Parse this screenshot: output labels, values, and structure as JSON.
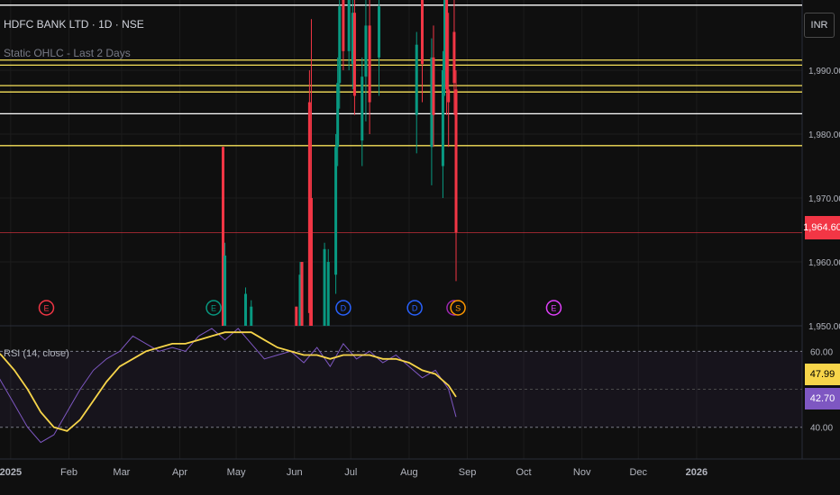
{
  "header": {
    "title": "HDFC BANK LTD · 1D · NSE",
    "indicator": "Static OHLC - Last 2 Days"
  },
  "currency_button": "INR",
  "last_price": "1,964.60",
  "rsi_panel": {
    "label": "RSI (14, close)",
    "ma_value": "47.99",
    "rsi_value": "42.70"
  },
  "colors": {
    "up": "#089981",
    "down": "#f23645",
    "level_white": "#ffffff",
    "level_yellow": "#f7e25a",
    "rsi": "#7e57c2",
    "rsi_ma": "#f7d54a",
    "bg": "#0f0f0f"
  },
  "chart_data": [
    {
      "type": "candlestick",
      "title": "HDFC BANK LTD · 1D · NSE",
      "ylim": [
        1950,
        2001
      ],
      "y_ticks": [
        "1,990.00",
        "1,980.00",
        "1,970.00",
        "1,960.00",
        "1,950.00"
      ],
      "x_ticks": [
        "2025",
        "Feb",
        "Mar",
        "Apr",
        "May",
        "Jun",
        "Jul",
        "Aug",
        "Sep",
        "Oct",
        "Nov",
        "Dec",
        "2026"
      ],
      "levels": [
        {
          "price": 2000.2,
          "color": "white"
        },
        {
          "price": 1991.6,
          "color": "yellow"
        },
        {
          "price": 1990.8,
          "color": "yellow"
        },
        {
          "price": 1987.6,
          "color": "yellow"
        },
        {
          "price": 1986.6,
          "color": "yellow"
        },
        {
          "price": 1983.2,
          "color": "white"
        },
        {
          "price": 1978.2,
          "color": "yellow"
        },
        {
          "price": 1964.6,
          "color": "red"
        }
      ],
      "candles": [
        {
          "date": "2025-04-24",
          "open": 1978,
          "close": 1950,
          "high": 1978,
          "low": 1950
        },
        {
          "date": "2025-04-25",
          "open": 1950,
          "close": 1961,
          "high": 1963,
          "low": 1950
        },
        {
          "date": "2025-05-06",
          "open": 1950,
          "close": 1955,
          "high": 1956,
          "low": 1950
        },
        {
          "date": "2025-05-09",
          "open": 1950,
          "close": 1953,
          "high": 1954,
          "low": 1950
        },
        {
          "date": "2025-06-02",
          "open": 1953,
          "close": 1950,
          "high": 1953,
          "low": 1950
        },
        {
          "date": "2025-06-04",
          "open": 1950,
          "close": 1958,
          "high": 1960,
          "low": 1950
        },
        {
          "date": "2025-06-05",
          "open": 1960,
          "close": 1950,
          "high": 1960,
          "low": 1950
        },
        {
          "date": "2025-06-09",
          "open": 1985,
          "close": 1952,
          "high": 1990,
          "low": 1950
        },
        {
          "date": "2025-06-10",
          "open": 1970,
          "close": 1950,
          "high": 1998,
          "low": 1950
        },
        {
          "date": "2025-06-17",
          "open": 1950,
          "close": 1962,
          "high": 1963,
          "low": 1950
        },
        {
          "date": "2025-06-19",
          "open": 1950,
          "close": 1960,
          "high": 1962,
          "low": 1950
        },
        {
          "date": "2025-06-23",
          "open": 1958,
          "close": 1978,
          "high": 1980,
          "low": 1955
        },
        {
          "date": "2025-06-24",
          "open": 1978,
          "close": 1988,
          "high": 1992,
          "low": 1975
        },
        {
          "date": "2025-06-25",
          "open": 1988,
          "close": 2000,
          "high": 2001,
          "low": 1984
        },
        {
          "date": "2025-06-27",
          "open": 2001,
          "close": 1993,
          "high": 2001,
          "low": 1990
        },
        {
          "date": "2025-06-30",
          "open": 1993,
          "close": 2001,
          "high": 2001,
          "low": 1990
        },
        {
          "date": "2025-07-02",
          "open": 1991,
          "close": 1999,
          "high": 2001,
          "low": 1987
        },
        {
          "date": "2025-07-03",
          "open": 1999,
          "close": 1986,
          "high": 2001,
          "low": 1983
        },
        {
          "date": "2025-07-07",
          "open": 1979,
          "close": 1989,
          "high": 1992,
          "low": 1975
        },
        {
          "date": "2025-07-09",
          "open": 1989,
          "close": 1997,
          "high": 2001,
          "low": 1982
        },
        {
          "date": "2025-07-11",
          "open": 1997,
          "close": 1985,
          "high": 2001,
          "low": 1980
        },
        {
          "date": "2025-07-16",
          "open": 1992,
          "close": 2000,
          "high": 2001,
          "low": 1986
        },
        {
          "date": "2025-08-05",
          "open": 1983,
          "close": 1994,
          "high": 1996,
          "low": 1977
        },
        {
          "date": "2025-08-08",
          "open": 2001,
          "close": 1991,
          "high": 2001,
          "low": 1985
        },
        {
          "date": "2025-08-13",
          "open": 1978,
          "close": 1992,
          "high": 1995,
          "low": 1972
        },
        {
          "date": "2025-08-14",
          "open": 1992,
          "close": 1983,
          "high": 1997,
          "low": 1978
        },
        {
          "date": "2025-08-19",
          "open": 1975,
          "close": 1990,
          "high": 1993,
          "low": 1970
        },
        {
          "date": "2025-08-20",
          "open": 1990,
          "close": 2001,
          "high": 2001,
          "low": 1986
        },
        {
          "date": "2025-08-21",
          "open": 2001,
          "close": 1987,
          "high": 2001,
          "low": 1983
        },
        {
          "date": "2025-08-22",
          "open": 1987,
          "close": 1985,
          "high": 1999,
          "low": 1978
        },
        {
          "date": "2025-08-25",
          "open": 1996,
          "close": 1988,
          "high": 2001,
          "low": 1983
        },
        {
          "date": "2025-08-26",
          "open": 1987,
          "close": 1964.6,
          "high": 1990,
          "low": 1957
        }
      ],
      "event_markers": [
        {
          "date": "2025-01-20",
          "label": "E",
          "color": "#f23645"
        },
        {
          "date": "2025-04-19",
          "label": "E",
          "color": "#089981"
        },
        {
          "date": "2025-06-27",
          "label": "D",
          "color": "#2962ff"
        },
        {
          "date": "2025-08-04",
          "label": "D",
          "color": "#2962ff"
        },
        {
          "date": "2025-08-25",
          "label": "",
          "color": "#9c27b0"
        },
        {
          "date": "2025-08-27",
          "label": "S",
          "color": "#ff9800"
        },
        {
          "date": "2025-10-17",
          "label": "E",
          "color": "#e040fb"
        }
      ]
    },
    {
      "type": "line",
      "title": "RSI (14, close)",
      "ylim": [
        34,
        66
      ],
      "y_ticks": [
        "60.00",
        "40.00"
      ],
      "x": [
        "2024-12-13",
        "2024-12-20",
        "2024-12-27",
        "2025-01-03",
        "2025-01-10",
        "2025-01-17",
        "2025-01-24",
        "2025-01-31",
        "2025-02-07",
        "2025-02-14",
        "2025-02-21",
        "2025-02-28",
        "2025-03-07",
        "2025-03-14",
        "2025-03-21",
        "2025-03-28",
        "2025-04-04",
        "2025-04-11",
        "2025-04-18",
        "2025-04-25",
        "2025-05-02",
        "2025-05-09",
        "2025-05-16",
        "2025-05-23",
        "2025-05-30",
        "2025-06-06",
        "2025-06-13",
        "2025-06-20",
        "2025-06-27",
        "2025-07-04",
        "2025-07-11",
        "2025-07-18",
        "2025-07-25",
        "2025-08-01",
        "2025-08-08",
        "2025-08-15",
        "2025-08-22",
        "2025-08-26"
      ],
      "series": [
        {
          "name": "RSI",
          "color": "#7e57c2",
          "values": [
            63,
            58,
            52,
            46,
            40,
            36,
            38,
            44,
            50,
            55,
            58,
            60,
            64,
            62,
            60,
            61,
            60,
            64,
            66,
            63,
            66,
            62,
            58,
            59,
            60,
            57,
            61,
            56,
            62,
            58,
            60,
            57,
            59,
            56,
            53,
            55,
            50,
            42.7
          ]
        },
        {
          "name": "MA",
          "color": "#f7d54a",
          "values": [
            64,
            62,
            59,
            55,
            50,
            44,
            40,
            39,
            42,
            47,
            52,
            56,
            58,
            60,
            61,
            62,
            62,
            63,
            64,
            65,
            65,
            65,
            63,
            61,
            60,
            59,
            59,
            58,
            59,
            59,
            59,
            58,
            58,
            57,
            55,
            54,
            51,
            47.99
          ]
        }
      ],
      "bands": [
        60,
        40
      ]
    }
  ]
}
